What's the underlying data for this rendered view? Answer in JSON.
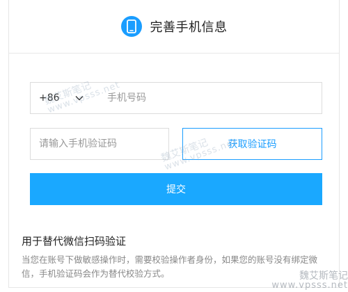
{
  "header": {
    "title": "完善手机信息",
    "icon": "phone-icon",
    "icon_color": "#1a9dff"
  },
  "form": {
    "country_code": "+86",
    "phone_placeholder": "手机号码",
    "code_placeholder": "请输入手机验证码",
    "get_code_label": "获取验证码",
    "submit_label": "提交"
  },
  "note": {
    "title": "用于替代微信扫码验证",
    "text": "当您在账号下做敏感操作时，需要校验操作者身份，如果您的账号没有绑定微信，手机验证码会作为替代校验方式。"
  },
  "watermarks": [
    {
      "line1": "魏艾斯笔记",
      "line2": "www.vpsss.net"
    },
    {
      "line1": "魏艾斯笔记",
      "line2": "www.vpsss.net"
    },
    {
      "line1": "魏艾斯笔记",
      "line2": "www.vpsss.net"
    }
  ],
  "colors": {
    "accent": "#1a9dff",
    "submit_bg": "#1aa8ff"
  }
}
